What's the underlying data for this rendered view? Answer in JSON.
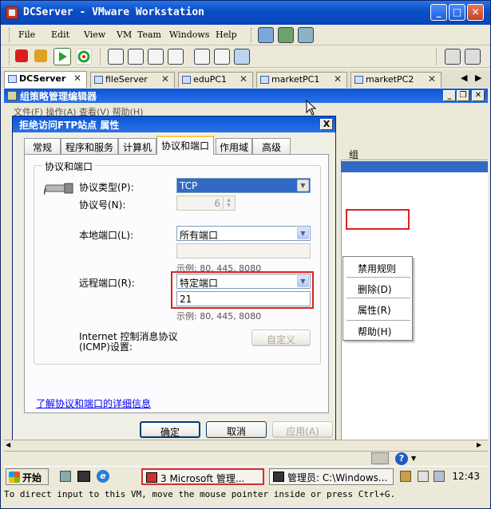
{
  "window": {
    "title": "DCServer - VMware Workstation"
  },
  "menu": [
    "File",
    "Edit",
    "View",
    "VM",
    "Team",
    "Windows",
    "Help"
  ],
  "vm_tabs": [
    {
      "label": "DCServer",
      "active": true
    },
    {
      "label": "fileServer"
    },
    {
      "label": "eduPC1"
    },
    {
      "label": "marketPC1"
    },
    {
      "label": "marketPC2"
    }
  ],
  "gpe": {
    "title": "组策略管理编辑器",
    "menu_hint": "文件(F)  操作(A)  查看(V)  帮助(H)",
    "column_header": "组"
  },
  "context_menu": [
    "禁用规则",
    "删除(D)",
    "属性(R)",
    "帮助(H)"
  ],
  "dialog": {
    "title": "拒绝访问FTP站点 属性",
    "close": "X",
    "tabs": [
      "常规",
      "程序和服务",
      "计算机",
      "协议和端口",
      "作用域",
      "高级"
    ],
    "group_label": "协议和端口",
    "protocol_type_label": "协议类型(P):",
    "protocol_type_value": "TCP",
    "protocol_number_label": "协议号(N):",
    "protocol_number_value": "6",
    "local_port_label": "本地端口(L):",
    "local_port_value": "所有端口",
    "local_example": "示例: 80, 445, 8080",
    "remote_port_label": "远程端口(R):",
    "remote_port_value": "特定端口",
    "remote_port_input": "21",
    "remote_example": "示例: 80, 445, 8080",
    "icmp_label": "Internet 控制消息协议(ICMP)设置:",
    "customize_button": "自定义",
    "learn_more": "了解协议和端口的详细信息",
    "ok": "确定",
    "cancel": "取消",
    "apply": "应用(A)"
  },
  "taskbar": {
    "start": "开始",
    "item1": "3 Microsoft 管理...",
    "item2": "管理员: C:\\Windows...",
    "clock": "12:43"
  },
  "status_message": "To direct input to this VM, move the mouse pointer inside or press Ctrl+G."
}
